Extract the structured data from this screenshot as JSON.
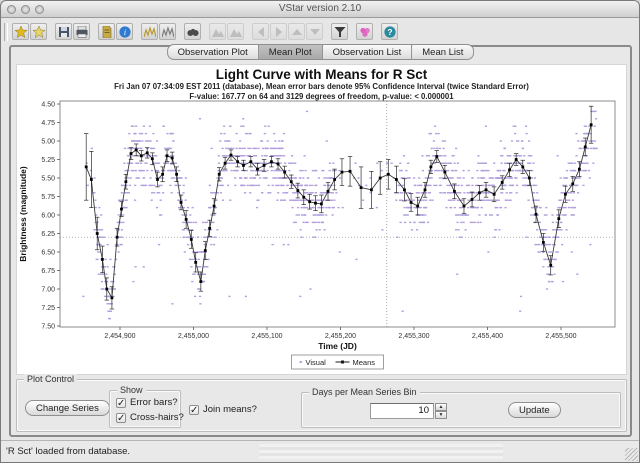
{
  "window": {
    "title": "VStar version 2.10",
    "status": "'R Sct' loaded from database."
  },
  "toolbar": {
    "icons": [
      {
        "name": "new-star-from-database",
        "glyph": "star",
        "color": "#e3b91f",
        "enabled": true,
        "gap": false
      },
      {
        "name": "new-star-from-file",
        "glyph": "star",
        "color": "#e8d46a",
        "enabled": true,
        "gap": false
      },
      {
        "name": "save",
        "glyph": "disk",
        "color": "#45566b",
        "enabled": true,
        "gap": true
      },
      {
        "name": "print",
        "glyph": "printer",
        "color": "#4d565e",
        "enabled": true,
        "gap": false
      },
      {
        "name": "observation-info",
        "glyph": "doc",
        "color": "#c6ab45",
        "enabled": true,
        "gap": true
      },
      {
        "name": "details",
        "glyph": "info-circle",
        "color": "#2f7bd0",
        "enabled": true,
        "gap": false
      },
      {
        "name": "raw-plot",
        "glyph": "bars",
        "color": "#b89a2e",
        "enabled": true,
        "gap": true
      },
      {
        "name": "phase-plot",
        "glyph": "bars",
        "color": "#7d7d7d",
        "enabled": true,
        "gap": false
      },
      {
        "name": "find",
        "glyph": "binoculars",
        "color": "#4a4a4a",
        "enabled": true,
        "gap": true
      },
      {
        "name": "zoom-in",
        "glyph": "mountain",
        "color": "#8e8e8e",
        "enabled": false,
        "gap": true
      },
      {
        "name": "zoom-out",
        "glyph": "mountain",
        "color": "#8e8e8e",
        "enabled": false,
        "gap": false
      },
      {
        "name": "pan-left",
        "glyph": "chev-left",
        "color": "#8e8e8e",
        "enabled": false,
        "gap": true
      },
      {
        "name": "pan-right",
        "glyph": "chev-right",
        "color": "#8e8e8e",
        "enabled": false,
        "gap": false
      },
      {
        "name": "pan-up",
        "glyph": "chev-up",
        "color": "#8e8e8e",
        "enabled": false,
        "gap": false
      },
      {
        "name": "pan-down",
        "glyph": "chev-down",
        "color": "#8e8e8e",
        "enabled": false,
        "gap": false
      },
      {
        "name": "filter",
        "glyph": "filter",
        "color": "#3a3a3a",
        "enabled": true,
        "gap": true
      },
      {
        "name": "polygon-filter",
        "glyph": "flower",
        "color": "#df5fc0",
        "enabled": true,
        "gap": true
      },
      {
        "name": "help",
        "glyph": "help",
        "color": "#2a8aa0",
        "enabled": true,
        "gap": true
      }
    ]
  },
  "tabs": {
    "items": [
      "Observation Plot",
      "Mean Plot",
      "Observation List",
      "Mean List"
    ],
    "selected": 1
  },
  "chart_data": {
    "type": "scatter",
    "title": "Light Curve with Means for R Sct",
    "subtitle1": "Fri Jan 07 07:34:09 EST 2011 (database), Mean error bars denote 95% Confidence Interval (twice Standard Error)",
    "subtitle2": "F-value: 167.77 on 64 and 3129 degrees of freedom, p-value: < 0.000001",
    "xlabel": "Time (JD)",
    "ylabel": "Brightness (magnitude)",
    "xlim": [
      2454818,
      2455573
    ],
    "ylim": [
      4.5,
      7.5
    ],
    "y_inverted": true,
    "y_ticks": [
      4.5,
      4.75,
      5.0,
      5.25,
      5.5,
      5.75,
      6.0,
      6.25,
      6.5,
      6.75,
      7.0,
      7.25,
      7.5
    ],
    "x_ticks": [
      {
        "v": 2454900,
        "label": "2,454,900"
      },
      {
        "v": 2455000,
        "label": "2,455,000"
      },
      {
        "v": 2455100,
        "label": "2,455,100"
      },
      {
        "v": 2455200,
        "label": "2,455,200"
      },
      {
        "v": 2455300,
        "label": "2,455,300"
      },
      {
        "v": 2455400,
        "label": "2,455,400"
      },
      {
        "v": 2455500,
        "label": "2,455,500"
      }
    ],
    "crosshair": {
      "x_jd": 2455263,
      "y_mag": 6.3
    },
    "legend": [
      {
        "label": "Visual",
        "color": "#a48fd8",
        "marker": "dot"
      },
      {
        "label": "Means",
        "color": "#1a1a1a",
        "marker": "line-square"
      }
    ],
    "series": [
      {
        "name": "Means",
        "type": "line+errorbars",
        "color": "#3a3a3a",
        "points": [
          [
            2454854,
            5.35,
            0.45
          ],
          [
            2454861,
            5.52,
            0.38
          ],
          [
            2454869,
            6.25,
            0.22
          ],
          [
            2454876,
            6.6,
            0.18
          ],
          [
            2454882,
            7.0,
            0.15
          ],
          [
            2454889,
            7.12,
            0.15
          ],
          [
            2454896,
            6.3,
            0.12
          ],
          [
            2454902,
            5.92,
            0.1
          ],
          [
            2454908,
            5.55,
            0.1
          ],
          [
            2454915,
            5.17,
            0.08
          ],
          [
            2454922,
            5.12,
            0.08
          ],
          [
            2454929,
            5.2,
            0.07
          ],
          [
            2454937,
            5.16,
            0.07
          ],
          [
            2454944,
            5.24,
            0.08
          ],
          [
            2454951,
            5.52,
            0.1
          ],
          [
            2454958,
            5.45,
            0.1
          ],
          [
            2454964,
            5.2,
            0.08
          ],
          [
            2454971,
            5.23,
            0.08
          ],
          [
            2454977,
            5.45,
            0.1
          ],
          [
            2454983,
            5.83,
            0.1
          ],
          [
            2454990,
            6.06,
            0.12
          ],
          [
            2454997,
            6.33,
            0.12
          ],
          [
            2455003,
            6.64,
            0.13
          ],
          [
            2455010,
            6.9,
            0.13
          ],
          [
            2455016,
            6.48,
            0.12
          ],
          [
            2455022,
            6.18,
            0.11
          ],
          [
            2455028,
            5.88,
            0.1
          ],
          [
            2455035,
            5.45,
            0.09
          ],
          [
            2455043,
            5.3,
            0.08
          ],
          [
            2455051,
            5.19,
            0.07
          ],
          [
            2455060,
            5.28,
            0.07
          ],
          [
            2455068,
            5.33,
            0.07
          ],
          [
            2455078,
            5.28,
            0.07
          ],
          [
            2455087,
            5.38,
            0.08
          ],
          [
            2455096,
            5.33,
            0.08
          ],
          [
            2455106,
            5.28,
            0.07
          ],
          [
            2455115,
            5.31,
            0.07
          ],
          [
            2455124,
            5.42,
            0.08
          ],
          [
            2455133,
            5.55,
            0.09
          ],
          [
            2455142,
            5.67,
            0.1
          ],
          [
            2455150,
            5.76,
            0.1
          ],
          [
            2455158,
            5.82,
            0.1
          ],
          [
            2455166,
            5.84,
            0.1
          ],
          [
            2455174,
            5.85,
            0.12
          ],
          [
            2455183,
            5.68,
            0.12
          ],
          [
            2455192,
            5.52,
            0.14
          ],
          [
            2455202,
            5.42,
            0.18
          ],
          [
            2455213,
            5.41,
            0.2
          ],
          [
            2455228,
            5.63,
            0.28
          ],
          [
            2455242,
            5.66,
            0.25
          ],
          [
            2455254,
            5.5,
            0.22
          ],
          [
            2455265,
            5.45,
            0.2
          ],
          [
            2455276,
            5.52,
            0.18
          ],
          [
            2455287,
            5.66,
            0.15
          ],
          [
            2455296,
            5.83,
            0.12
          ],
          [
            2455305,
            5.88,
            0.12
          ],
          [
            2455315,
            5.66,
            0.1
          ],
          [
            2455323,
            5.35,
            0.09
          ],
          [
            2455331,
            5.21,
            0.08
          ],
          [
            2455342,
            5.42,
            0.09
          ],
          [
            2455355,
            5.68,
            0.1
          ],
          [
            2455368,
            5.88,
            0.1
          ],
          [
            2455379,
            5.79,
            0.1
          ],
          [
            2455389,
            5.7,
            0.1
          ],
          [
            2455398,
            5.66,
            0.1
          ],
          [
            2455409,
            5.72,
            0.1
          ],
          [
            2455420,
            5.56,
            0.09
          ],
          [
            2455430,
            5.39,
            0.09
          ],
          [
            2455439,
            5.25,
            0.08
          ],
          [
            2455448,
            5.35,
            0.09
          ],
          [
            2455457,
            5.5,
            0.1
          ],
          [
            2455466,
            5.99,
            0.11
          ],
          [
            2455476,
            6.37,
            0.12
          ],
          [
            2455486,
            6.68,
            0.13
          ],
          [
            2455497,
            6.05,
            0.12
          ],
          [
            2455506,
            5.72,
            0.11
          ],
          [
            2455516,
            5.58,
            0.1
          ],
          [
            2455525,
            5.38,
            0.1
          ],
          [
            2455533,
            5.08,
            0.12
          ],
          [
            2455541,
            4.78,
            0.25
          ]
        ]
      }
    ],
    "visual_scatter": {
      "name": "Visual",
      "color": "#a48fd8",
      "approx_count": 3194,
      "spread_mag": 0.28,
      "quantize_mag": 0.1,
      "per_day_max": 5,
      "seed": 42,
      "jd_range": [
        2454850,
        2455548
      ],
      "sparse_ranges": [
        [
          2454818,
          2454864
        ],
        [
          2455192,
          2455280
        ]
      ],
      "outlier_count": 70
    }
  },
  "plot_control": {
    "title": "Plot Control",
    "change_series_label": "Change Series",
    "show_group_title": "Show",
    "error_bars_label": "Error bars?",
    "error_bars_checked": true,
    "cross_hairs_label": "Cross-hairs?",
    "cross_hairs_checked": true,
    "join_means_label": "Join means?",
    "join_means_checked": true,
    "bin_group_title": "Days per Mean Series Bin",
    "bin_value": "10",
    "update_label": "Update",
    "check_glyph": "✓",
    "spin_up_glyph": "▲",
    "spin_down_glyph": "▼"
  }
}
